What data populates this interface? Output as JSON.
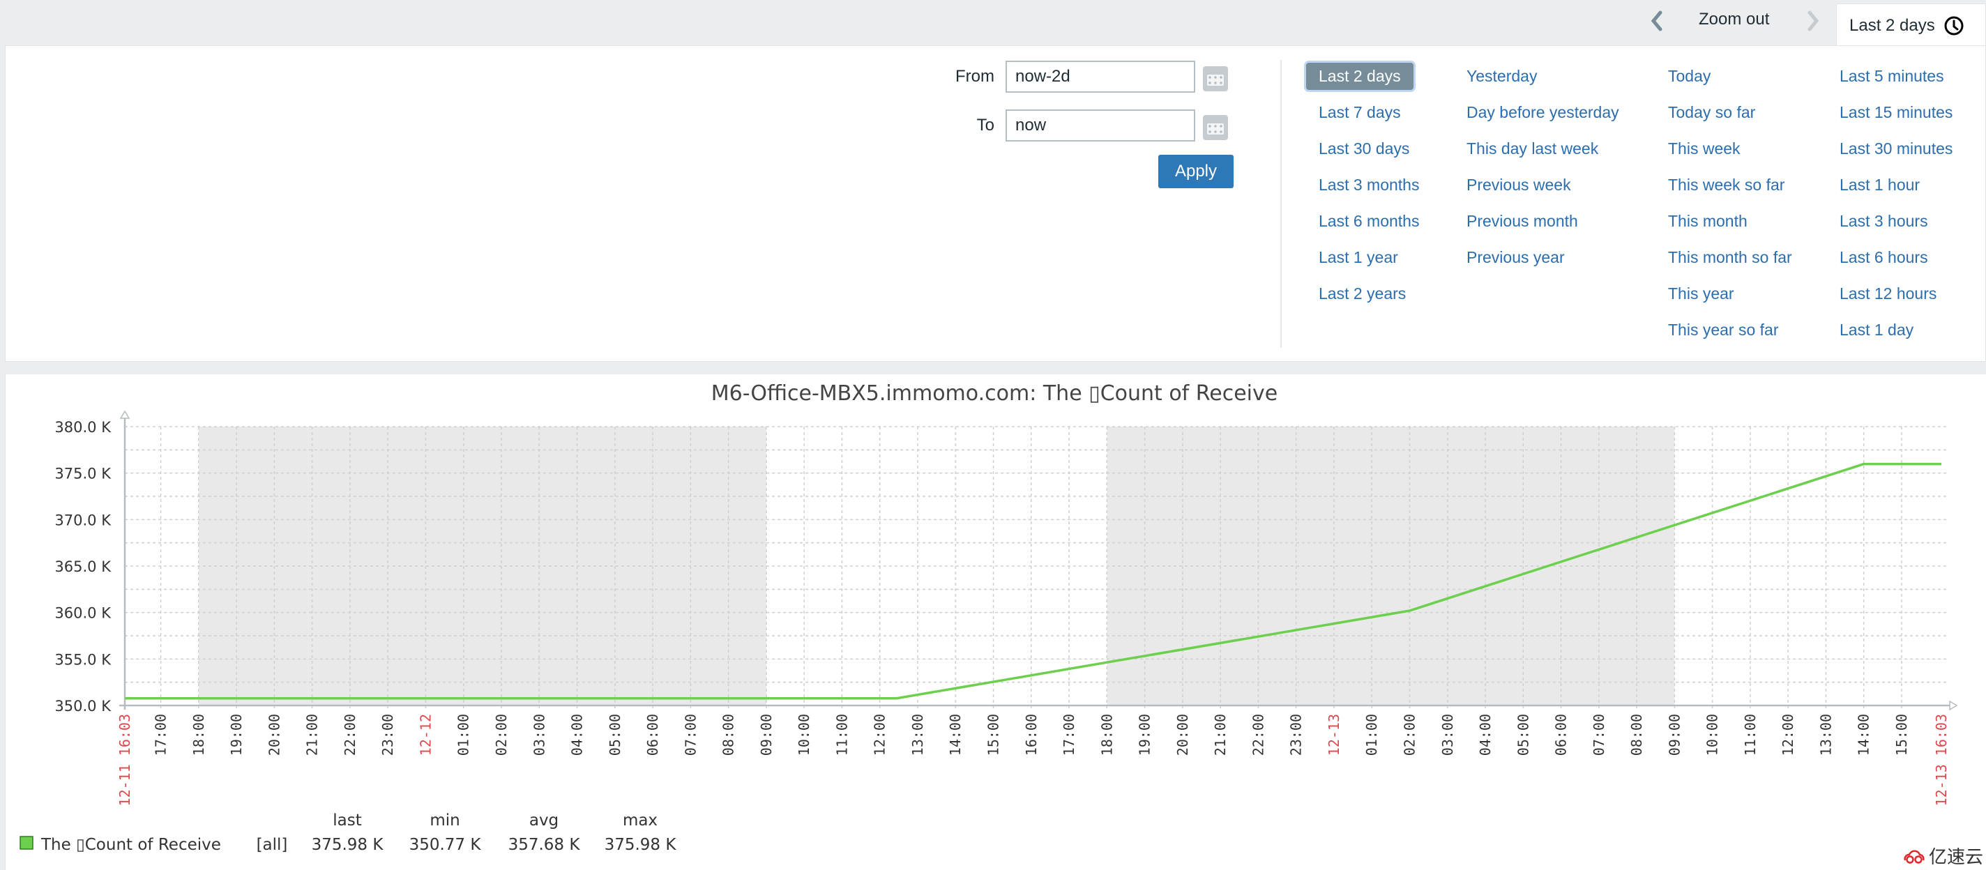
{
  "tabbar": {
    "prev_icon": "chevron-left-icon",
    "zoom_out_label": "Zoom out",
    "next_icon": "chevron-right-icon",
    "active_tab_label": "Last 2 days",
    "clock_icon": "clock-icon"
  },
  "filter": {
    "from_label": "From",
    "from_value": "now-2d",
    "to_label": "To",
    "to_value": "now",
    "apply_label": "Apply",
    "quick_ranges": [
      [
        "Last 2 days",
        "Last 7 days",
        "Last 30 days",
        "Last 3 months",
        "Last 6 months",
        "Last 1 year",
        "Last 2 years"
      ],
      [
        "Yesterday",
        "Day before yesterday",
        "This day last week",
        "Previous week",
        "Previous month",
        "Previous year"
      ],
      [
        "Today",
        "Today so far",
        "This week",
        "This week so far",
        "This month",
        "This month so far",
        "This year",
        "This year so far"
      ],
      [
        "Last 5 minutes",
        "Last 15 minutes",
        "Last 30 minutes",
        "Last 1 hour",
        "Last 3 hours",
        "Last 6 hours",
        "Last 12 hours",
        "Last 1 day"
      ]
    ],
    "selected_range": "Last 2 days"
  },
  "colors": {
    "series": "#6ccf4e",
    "link": "#2b6eb0",
    "apply": "#2f78b8",
    "selected_bg": "#768d99",
    "date_label": "#e0474c",
    "shade": "#e9e9e9"
  },
  "chart_data": {
    "type": "line",
    "title": "M6-Office-MBX5.immomo.com: The ▯Count of Receive",
    "xlabel": "",
    "ylabel": "",
    "ylim": [
      350000,
      380000
    ],
    "y_ticks": [
      "380.0 K",
      "375.0 K",
      "370.0 K",
      "365.0 K",
      "360.0 K",
      "355.0 K",
      "350.0 K"
    ],
    "x_range_hours": [
      0,
      48
    ],
    "x_start_label": "12-11 16:03",
    "x_end_label": "12-13 16:03",
    "x_ticks": [
      {
        "h": 0.95,
        "label": "17:00"
      },
      {
        "h": 1.95,
        "label": "18:00"
      },
      {
        "h": 2.95,
        "label": "19:00"
      },
      {
        "h": 3.95,
        "label": "20:00"
      },
      {
        "h": 4.95,
        "label": "21:00"
      },
      {
        "h": 5.95,
        "label": "22:00"
      },
      {
        "h": 6.95,
        "label": "23:00"
      },
      {
        "h": 7.95,
        "label": "12-12",
        "date": true
      },
      {
        "h": 8.95,
        "label": "01:00"
      },
      {
        "h": 9.95,
        "label": "02:00"
      },
      {
        "h": 10.95,
        "label": "03:00"
      },
      {
        "h": 11.95,
        "label": "04:00"
      },
      {
        "h": 12.95,
        "label": "05:00"
      },
      {
        "h": 13.95,
        "label": "06:00"
      },
      {
        "h": 14.95,
        "label": "07:00"
      },
      {
        "h": 15.95,
        "label": "08:00"
      },
      {
        "h": 16.95,
        "label": "09:00"
      },
      {
        "h": 17.95,
        "label": "10:00"
      },
      {
        "h": 18.95,
        "label": "11:00"
      },
      {
        "h": 19.95,
        "label": "12:00"
      },
      {
        "h": 20.95,
        "label": "13:00"
      },
      {
        "h": 21.95,
        "label": "14:00"
      },
      {
        "h": 22.95,
        "label": "15:00"
      },
      {
        "h": 23.95,
        "label": "16:00"
      },
      {
        "h": 24.95,
        "label": "17:00"
      },
      {
        "h": 25.95,
        "label": "18:00"
      },
      {
        "h": 26.95,
        "label": "19:00"
      },
      {
        "h": 27.95,
        "label": "20:00"
      },
      {
        "h": 28.95,
        "label": "21:00"
      },
      {
        "h": 29.95,
        "label": "22:00"
      },
      {
        "h": 30.95,
        "label": "23:00"
      },
      {
        "h": 31.95,
        "label": "12-13",
        "date": true
      },
      {
        "h": 32.95,
        "label": "01:00"
      },
      {
        "h": 33.95,
        "label": "02:00"
      },
      {
        "h": 34.95,
        "label": "03:00"
      },
      {
        "h": 35.95,
        "label": "04:00"
      },
      {
        "h": 36.95,
        "label": "05:00"
      },
      {
        "h": 37.95,
        "label": "06:00"
      },
      {
        "h": 38.95,
        "label": "07:00"
      },
      {
        "h": 39.95,
        "label": "08:00"
      },
      {
        "h": 40.95,
        "label": "09:00"
      },
      {
        "h": 41.95,
        "label": "10:00"
      },
      {
        "h": 42.95,
        "label": "11:00"
      },
      {
        "h": 43.95,
        "label": "12:00"
      },
      {
        "h": 44.95,
        "label": "13:00"
      },
      {
        "h": 45.95,
        "label": "14:00"
      },
      {
        "h": 46.95,
        "label": "15:00"
      }
    ],
    "shaded_periods_hours": [
      [
        1.95,
        16.95
      ],
      [
        25.95,
        40.95
      ]
    ],
    "grid": true,
    "series": [
      {
        "name": "The ▯Count of Receive",
        "points_hours_value": [
          [
            0,
            350770
          ],
          [
            20.4,
            350770
          ],
          [
            33.95,
            360200
          ],
          [
            45.95,
            375980
          ],
          [
            48,
            375980
          ]
        ]
      }
    ],
    "legend": {
      "position": "bottom-left",
      "headers": [
        "last",
        "min",
        "avg",
        "max"
      ],
      "entries": [
        {
          "name": "The ▯Count of Receive",
          "scope": "[all]",
          "last": "375.98 K",
          "min": "350.77 K",
          "avg": "357.68 K",
          "max": "375.98 K"
        }
      ]
    }
  },
  "watermark": "亿速云"
}
